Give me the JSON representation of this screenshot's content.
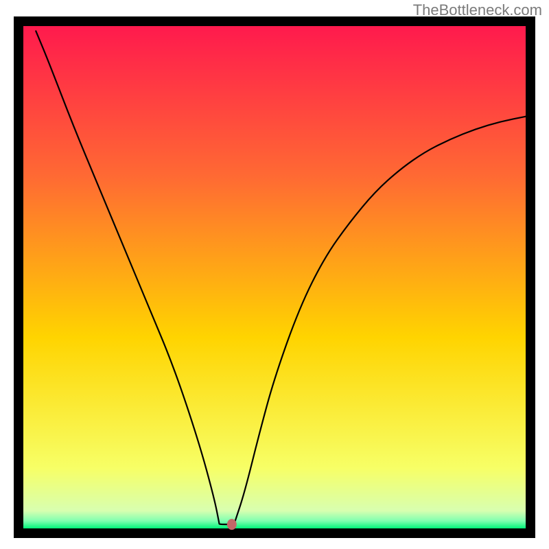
{
  "watermark": "TheBottleneck.com",
  "chart_data": {
    "type": "line",
    "title": "",
    "xlabel": "",
    "ylabel": "",
    "xlim": [
      0,
      100
    ],
    "ylim": [
      0,
      100
    ],
    "background_gradient": {
      "top": "#ff1a4d",
      "mid_upper": "#ff6a33",
      "mid": "#ffd400",
      "mid_lower": "#f7ff66",
      "bottom": "#00f57a"
    },
    "curve": {
      "description": "V-shaped curve dipping to zero near x≈41",
      "left_branch": [
        {
          "x": 2.5,
          "y": 99
        },
        {
          "x": 5,
          "y": 93
        },
        {
          "x": 10,
          "y": 80
        },
        {
          "x": 15,
          "y": 68
        },
        {
          "x": 20,
          "y": 56
        },
        {
          "x": 25,
          "y": 44
        },
        {
          "x": 30,
          "y": 32
        },
        {
          "x": 35,
          "y": 17
        },
        {
          "x": 38,
          "y": 6
        },
        {
          "x": 39,
          "y": 1
        }
      ],
      "trough": [
        {
          "x": 39,
          "y": 0.8
        },
        {
          "x": 42,
          "y": 0.8
        }
      ],
      "right_branch": [
        {
          "x": 42,
          "y": 1
        },
        {
          "x": 44,
          "y": 7
        },
        {
          "x": 47,
          "y": 19
        },
        {
          "x": 50,
          "y": 30
        },
        {
          "x": 55,
          "y": 44
        },
        {
          "x": 60,
          "y": 54
        },
        {
          "x": 65,
          "y": 61
        },
        {
          "x": 70,
          "y": 67
        },
        {
          "x": 75,
          "y": 71.5
        },
        {
          "x": 80,
          "y": 75
        },
        {
          "x": 85,
          "y": 77.5
        },
        {
          "x": 90,
          "y": 79.5
        },
        {
          "x": 95,
          "y": 81
        },
        {
          "x": 100,
          "y": 82
        }
      ]
    },
    "marker": {
      "x": 41.5,
      "y": 0.8,
      "color": "#c46868"
    },
    "frame_color": "#000000",
    "frame_thickness": 14
  }
}
